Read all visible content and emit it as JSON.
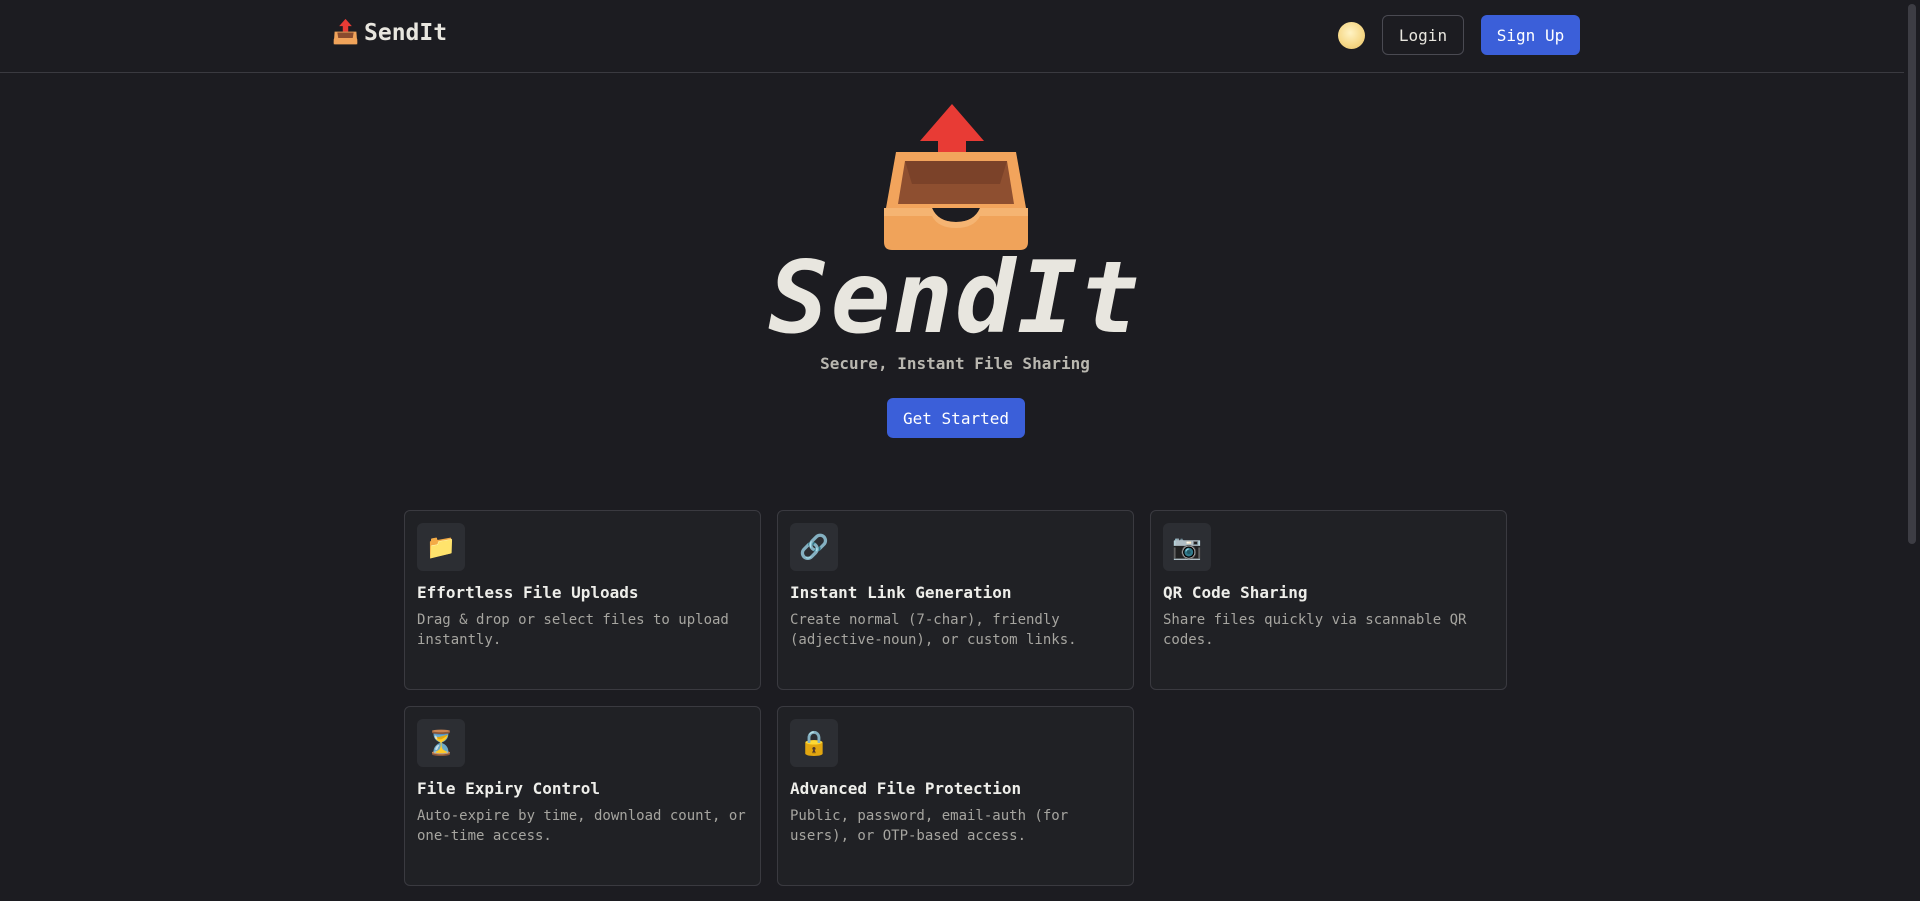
{
  "header": {
    "brand_icon": "outbox-tray-icon",
    "brand_name": "SendIt",
    "theme_toggle_icon": "moon-icon",
    "login_label": "Login",
    "signup_label": "Sign Up"
  },
  "hero": {
    "icon": "outbox-tray-icon",
    "title": "SendIt",
    "subtitle": "Secure, Instant File Sharing",
    "cta_label": "Get Started"
  },
  "features": [
    {
      "icon": "folder-icon",
      "glyph": "📁",
      "title": "Effortless File Uploads",
      "description": "Drag & drop or select files to upload instantly."
    },
    {
      "icon": "link-icon",
      "glyph": "🔗",
      "title": "Instant Link Generation",
      "description": "Create normal (7-char), friendly (adjective-noun), or custom links."
    },
    {
      "icon": "camera-icon",
      "glyph": "📷",
      "title": "QR Code Sharing",
      "description": "Share files quickly via scannable QR codes."
    },
    {
      "icon": "hourglass-icon",
      "glyph": "⏳",
      "title": "File Expiry Control",
      "description": "Auto-expire by time, download count, or one-time access."
    },
    {
      "icon": "lock-icon",
      "glyph": "🔒",
      "title": "Advanced File Protection",
      "description": "Public, password, email-auth (for users), or OTP-based access."
    }
  ],
  "colors": {
    "background": "#1c1c21",
    "card_background": "#202125",
    "accent": "#3b5fd9",
    "text": "#e8e6df",
    "muted_text": "#a6a5a0",
    "tray_orange": "#f0a35a",
    "arrow_red": "#e83b35"
  }
}
